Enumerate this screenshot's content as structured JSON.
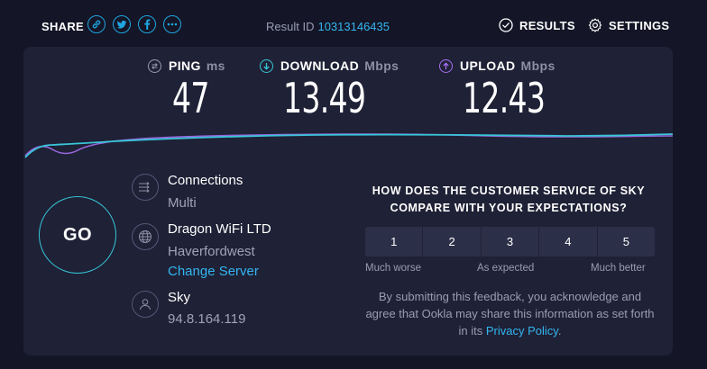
{
  "header": {
    "share_label": "SHARE",
    "share_buttons": [
      "link-icon",
      "twitter-icon",
      "facebook-icon",
      "more-icon"
    ],
    "result_label": "Result ID",
    "result_id": "10313146435",
    "results_label": "RESULTS",
    "settings_label": "SETTINGS"
  },
  "metrics": {
    "ping": {
      "label": "PING",
      "unit": "ms",
      "value": "47",
      "icon": "ping-icon",
      "color": "#9a9cb3"
    },
    "download": {
      "label": "DOWNLOAD",
      "unit": "Mbps",
      "value": "13.49",
      "icon": "download-arrow-icon",
      "color": "#37c6d8"
    },
    "upload": {
      "label": "UPLOAD",
      "unit": "Mbps",
      "value": "12.43",
      "icon": "upload-arrow-icon",
      "color": "#a66ff0"
    }
  },
  "go_label": "GO",
  "info": {
    "connections": {
      "title": "Connections",
      "value": "Multi",
      "icon": "connections-icon"
    },
    "server": {
      "title": "Dragon WiFi LTD",
      "location": "Haverfordwest",
      "change_label": "Change Server",
      "icon": "globe-icon"
    },
    "provider": {
      "title": "Sky",
      "ip": "94.8.164.119",
      "icon": "user-icon"
    }
  },
  "survey": {
    "question": "HOW DOES THE CUSTOMER SERVICE OF SKY COMPARE WITH YOUR EXPECTATIONS?",
    "ratings": [
      "1",
      "2",
      "3",
      "4",
      "5"
    ],
    "scale_low": "Much worse",
    "scale_mid": "As expected",
    "scale_high": "Much better",
    "disclaimer_text": "By submitting this feedback, you acknowledge and agree that Ookla may share this information as set forth in its",
    "privacy_link": "Privacy Policy",
    "disclaimer_end": "."
  },
  "colors": {
    "background": "#141526",
    "panel": "#1f2136",
    "accent_blue": "#33b6f0",
    "download": "#37c6d8",
    "upload": "#a66ff0"
  }
}
